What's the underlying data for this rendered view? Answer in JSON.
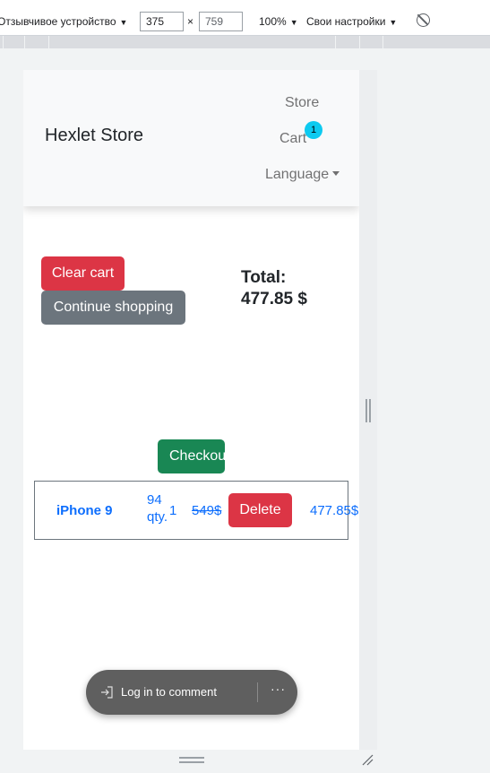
{
  "devtools": {
    "device": "Отзывчивое устройство",
    "width": "375",
    "times": "×",
    "height": "759",
    "zoom": "100%",
    "throttle": "Свои настройки"
  },
  "navbar": {
    "brand": "Hexlet Store",
    "store": "Store",
    "cart": "Cart",
    "cart_badge": "1",
    "language": "Language"
  },
  "cart": {
    "clear_label": "Clear cart",
    "continue_label": "Continue shopping",
    "total_label": "Total:",
    "total_value": "477.85 $",
    "checkout_label": "Checkout",
    "items": [
      {
        "name": "iPhone 9",
        "stock_count": "94",
        "stock_unit": "qty.",
        "quantity": "1",
        "price": "549$",
        "delete_label": "Delete",
        "sum": "477.85$"
      }
    ]
  },
  "toast": {
    "login_label": "Log in to comment",
    "more": "···"
  }
}
